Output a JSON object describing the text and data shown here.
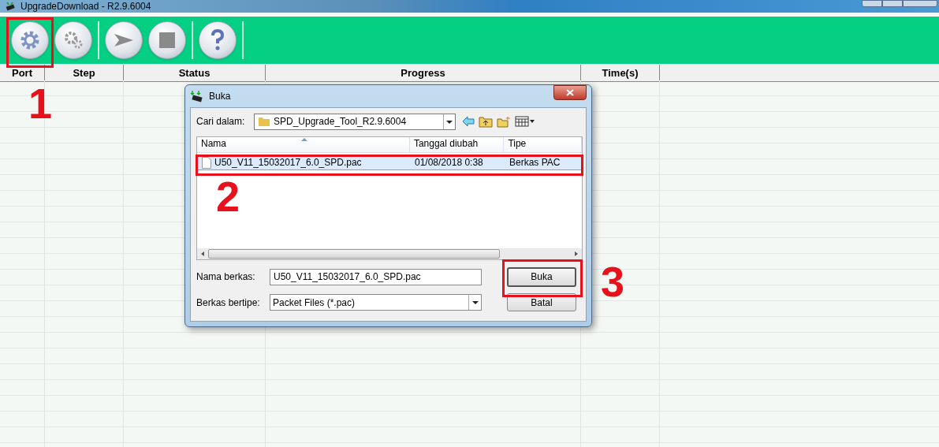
{
  "window": {
    "title": "UpgradeDownload - R2.9.6004"
  },
  "table": {
    "columns": [
      "Port",
      "Step",
      "Status",
      "Progress",
      "Time(s)"
    ]
  },
  "dialog": {
    "title": "Buka",
    "look_in_label": "Cari dalam:",
    "look_in_value": "SPD_Upgrade_Tool_R2.9.6004",
    "file_columns": [
      "Nama",
      "Tanggal diubah",
      "Tipe"
    ],
    "files": [
      {
        "name": "U50_V11_15032017_6.0_SPD.pac",
        "date": "01/08/2018 0:38",
        "type": "Berkas PAC",
        "selected": true
      }
    ],
    "file_name_label": "Nama berkas:",
    "file_name_value": "U50_V11_15032017_6.0_SPD.pac",
    "file_type_label": "Berkas bertipe:",
    "file_type_value": "Packet Files (*.pac)",
    "buttons": [
      "Buka",
      "Batal"
    ]
  },
  "annotations": [
    {
      "label": "1"
    },
    {
      "label": "2"
    },
    {
      "label": "3"
    }
  ]
}
